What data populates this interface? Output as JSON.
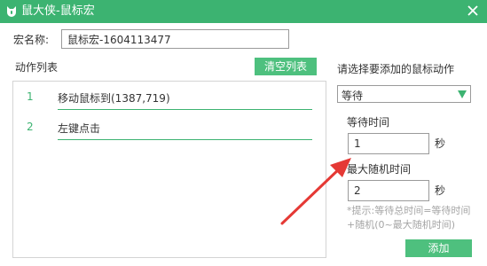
{
  "window": {
    "title": "鼠大侠-鼠标宏",
    "close_icon": "close-icon",
    "logo_icon": "app-logo-icon"
  },
  "macro_name": {
    "label": "宏名称:",
    "value": "鼠标宏-1604113477"
  },
  "action_list": {
    "label": "动作列表",
    "clear_button": "清空列表",
    "items": [
      {
        "num": "1",
        "text": "移动鼠标到(1387,719)"
      },
      {
        "num": "2",
        "text": "左键点击"
      }
    ]
  },
  "right_panel": {
    "choose_label": "请选择要添加的鼠标动作",
    "action_select": {
      "value": "等待",
      "icon": "caret-down-icon"
    },
    "wait_label": "等待时间",
    "wait_value": "1",
    "wait_unit": "秒",
    "random_label": "最大随机时间",
    "random_value": "2",
    "random_unit": "秒",
    "hint_line1": "*提示:等待总时间=等待时间",
    "hint_line2": "+随机(0~最大随机时间)",
    "add_button": "添加"
  },
  "colors": {
    "accent": "#3cb371",
    "button": "#4ec07e",
    "annotation_arrow": "#e53935",
    "hint": "#a5a5a5"
  }
}
